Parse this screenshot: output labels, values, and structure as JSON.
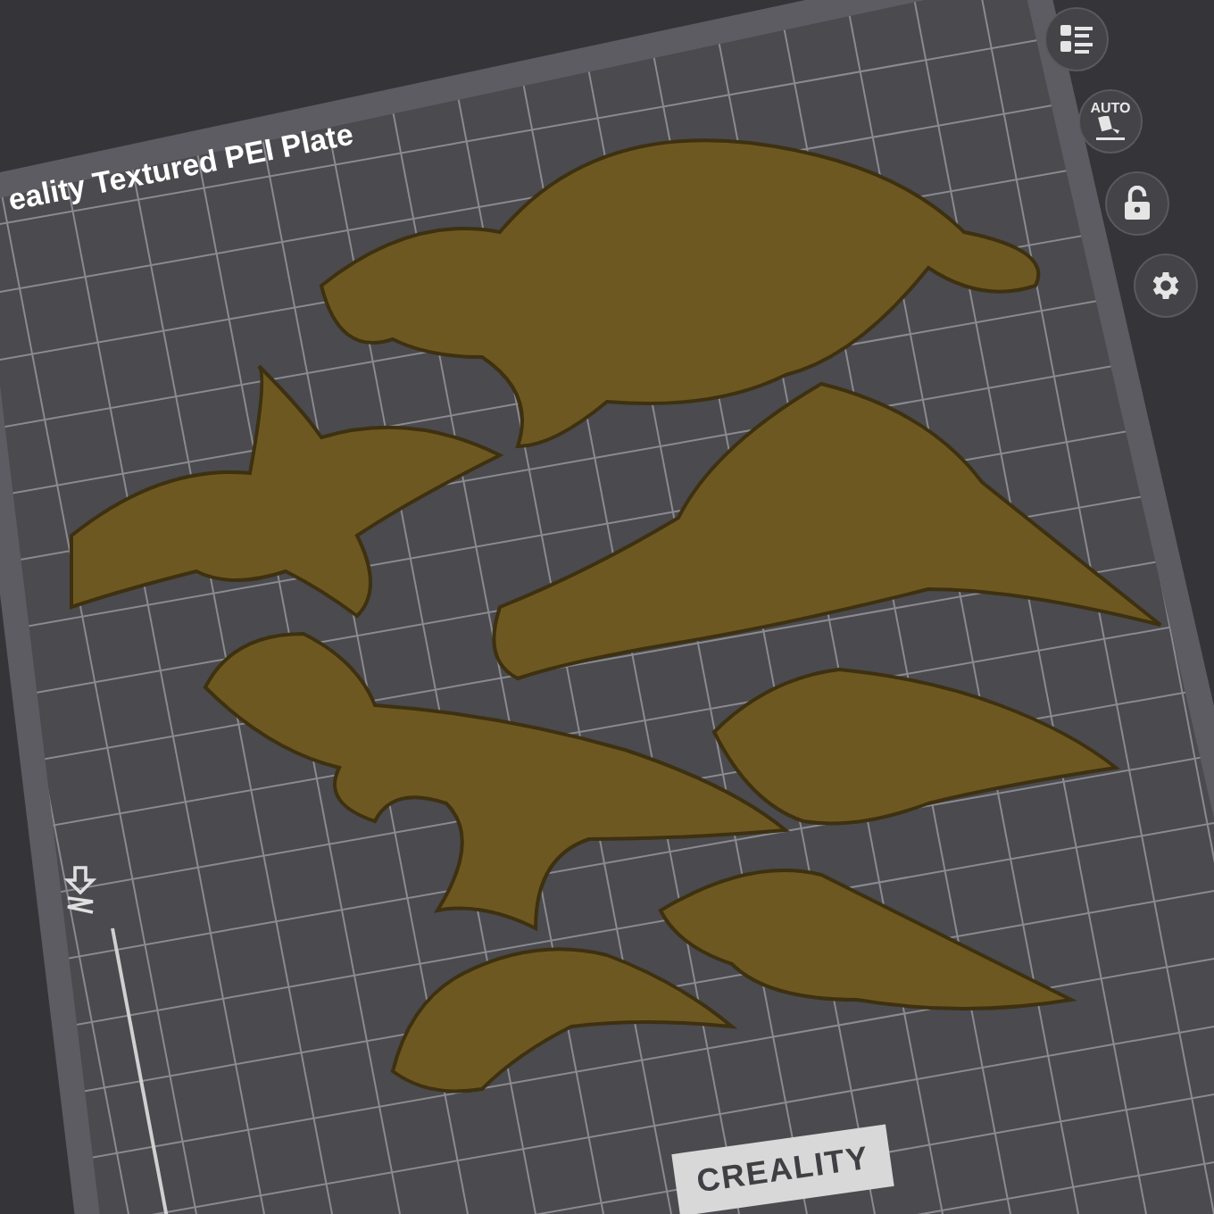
{
  "plate": {
    "label": "eality Textured PEI Plate",
    "logo": "CREALITY"
  },
  "toolbar": [
    {
      "kind": "objects"
    },
    {
      "kind": "arrange",
      "label": "AUTO"
    },
    {
      "kind": "lock"
    },
    {
      "kind": "settings"
    }
  ]
}
